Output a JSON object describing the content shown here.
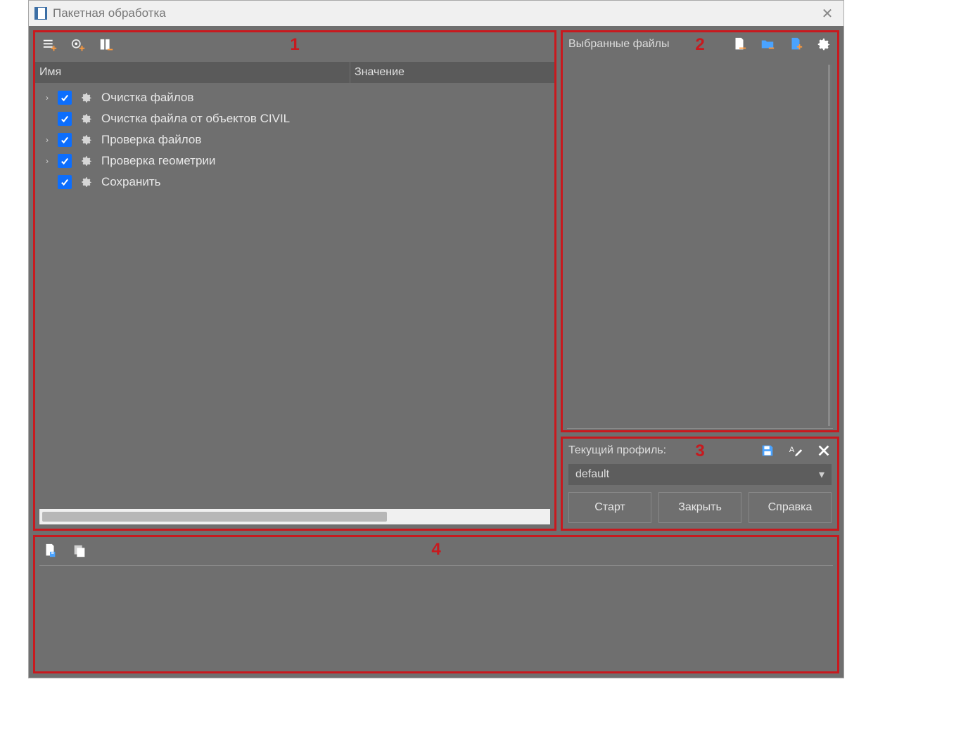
{
  "window": {
    "title": "Пакетная обработка"
  },
  "panel1": {
    "number": "1",
    "columns": {
      "name": "Имя",
      "value": "Значение"
    },
    "items": [
      {
        "expandable": true,
        "checked": true,
        "label": "Очистка файлов"
      },
      {
        "expandable": false,
        "checked": true,
        "label": "Очистка файла от объектов CIVIL"
      },
      {
        "expandable": true,
        "checked": true,
        "label": "Проверка файлов"
      },
      {
        "expandable": true,
        "checked": true,
        "label": "Проверка геометрии"
      },
      {
        "expandable": false,
        "checked": true,
        "label": "Сохранить"
      }
    ]
  },
  "panel2": {
    "number": "2",
    "label": "Выбранные файлы"
  },
  "panel3": {
    "number": "3",
    "label": "Текущий профиль:",
    "profile_selected": "default",
    "buttons": {
      "start": "Старт",
      "close": "Закрыть",
      "help": "Справка"
    }
  },
  "panel4": {
    "number": "4"
  }
}
